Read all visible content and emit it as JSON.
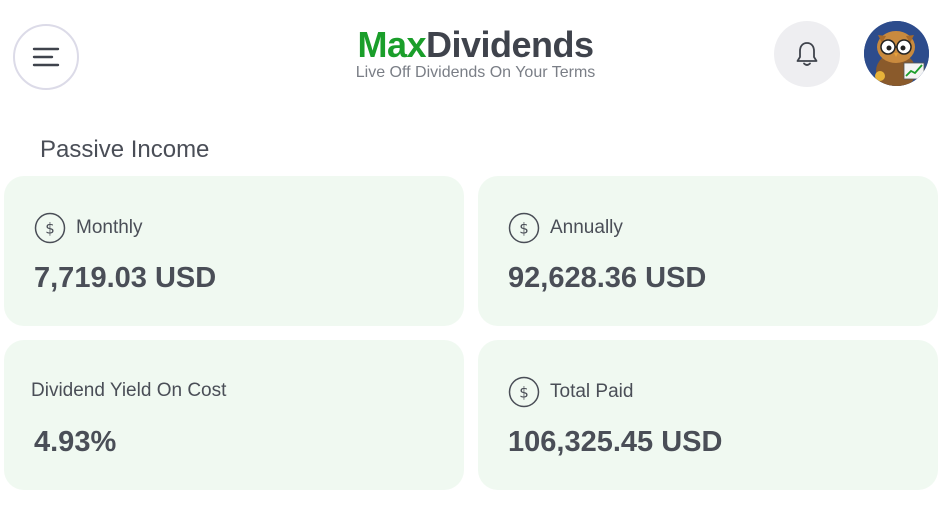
{
  "header": {
    "brand_primary": "Max",
    "brand_secondary": "Dividends",
    "tagline": "Live Off Dividends On Your Terms",
    "menu_icon": "hamburger-menu-icon",
    "notification_icon": "bell-icon",
    "avatar_icon": "owl-avatar"
  },
  "section": {
    "title": "Passive Income"
  },
  "cards": [
    {
      "label": "Monthly",
      "value": "7,719.03 USD",
      "icon": "dollar-coin-icon"
    },
    {
      "label": "Annually",
      "value": "92,628.36 USD",
      "icon": "dollar-coin-icon"
    },
    {
      "label": "Dividend Yield On Cost",
      "value": "4.93%",
      "icon": ""
    },
    {
      "label": "Total Paid",
      "value": "106,325.45 USD",
      "icon": "dollar-coin-icon"
    }
  ],
  "colors": {
    "brand_green": "#1a9e2a",
    "brand_dark": "#3f434c",
    "card_bg": "#f0f9f1",
    "text": "#4a4e57"
  }
}
